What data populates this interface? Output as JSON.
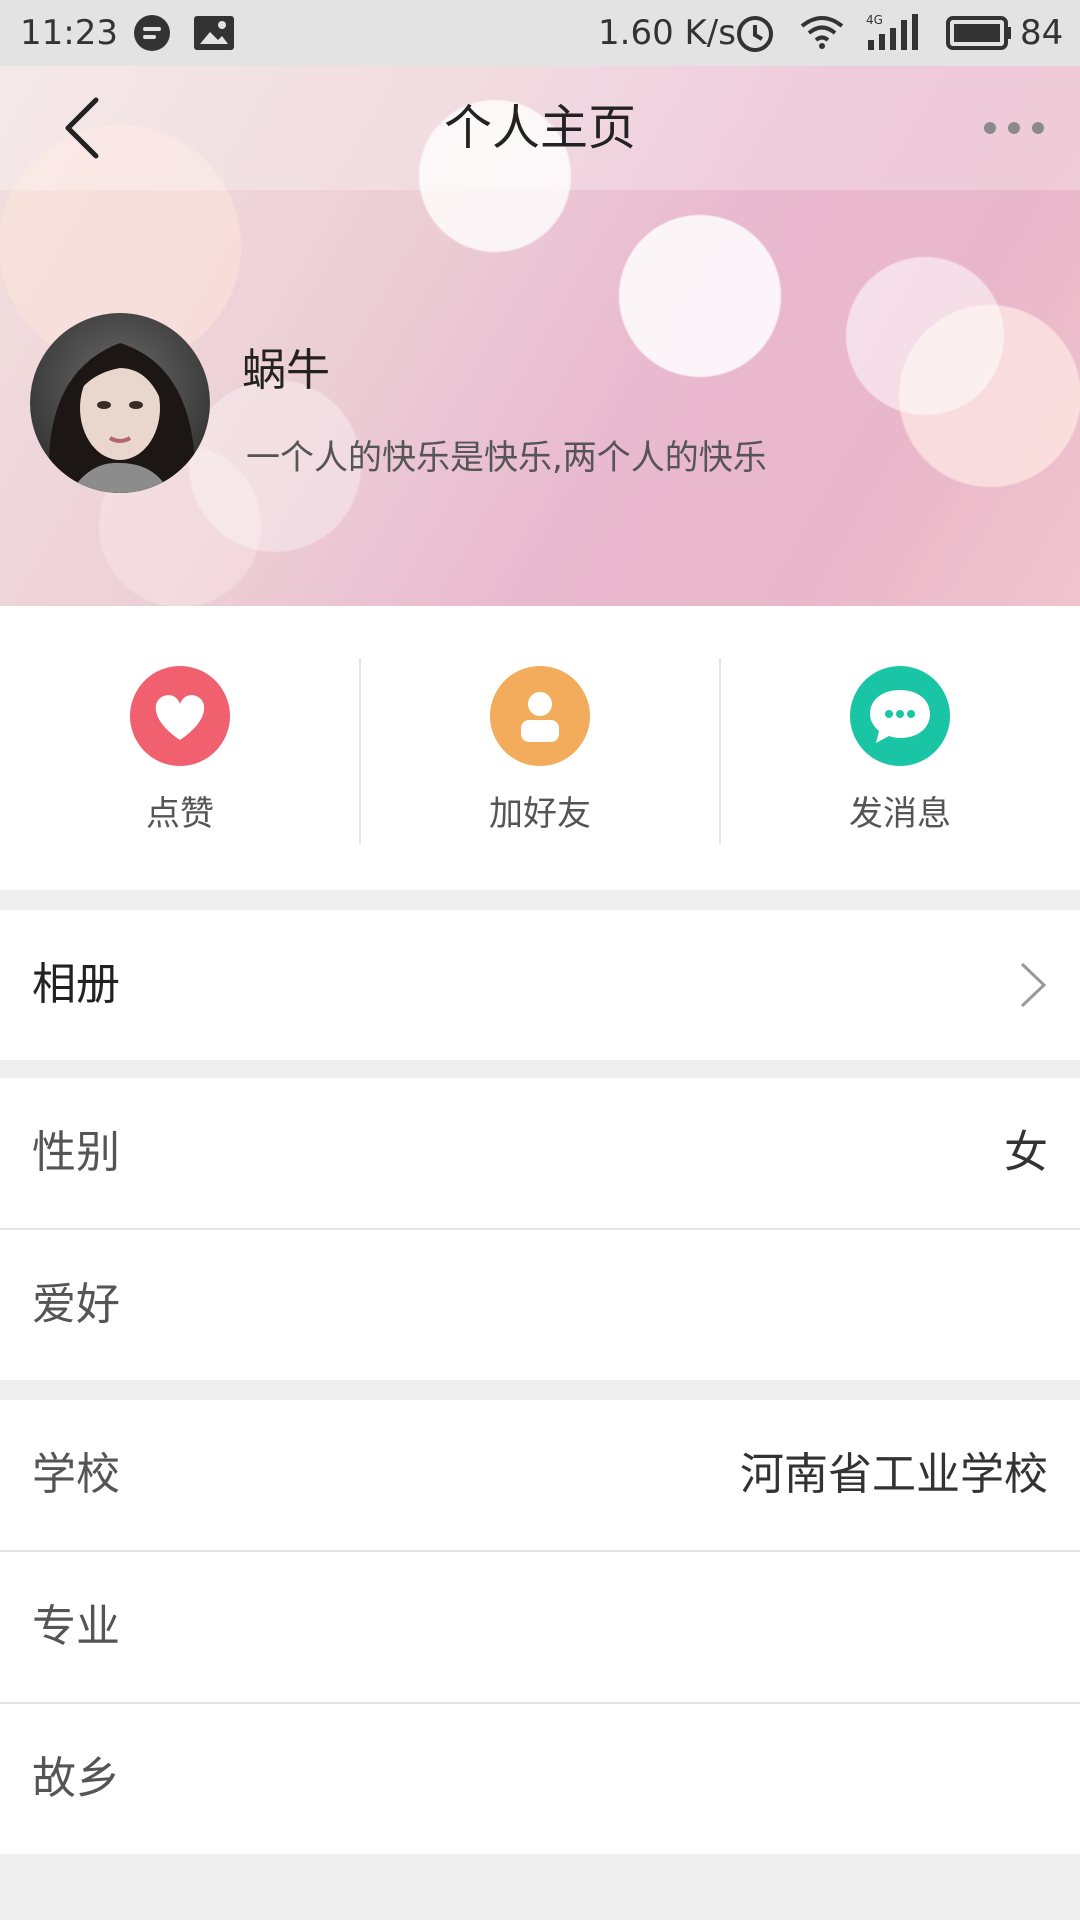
{
  "status_bar": {
    "time": "11:23",
    "speed": "1.60 K/s",
    "network": "4G",
    "battery": "84"
  },
  "header": {
    "title": "个人主页",
    "back_icon": "back-arrow-icon",
    "more_icon": "more-dots-icon"
  },
  "profile": {
    "name": "蜗牛",
    "signature": "一个人的快乐是快乐,两个人的快乐"
  },
  "actions": [
    {
      "label": "点赞",
      "icon": "heart-icon",
      "color": "#f0606e"
    },
    {
      "label": "加好友",
      "icon": "person-icon",
      "color": "#f2ac5b"
    },
    {
      "label": "发消息",
      "icon": "chat-bubble-icon",
      "color": "#1ac5a5"
    }
  ],
  "sections": {
    "album": {
      "label": "相册"
    },
    "gender": {
      "label": "性别",
      "value": "女"
    },
    "hobby": {
      "label": "爱好",
      "value": ""
    },
    "school": {
      "label": "学校",
      "value": "河南省工业学校"
    },
    "major": {
      "label": "专业",
      "value": ""
    },
    "hometown": {
      "label": "故乡",
      "value": ""
    }
  }
}
